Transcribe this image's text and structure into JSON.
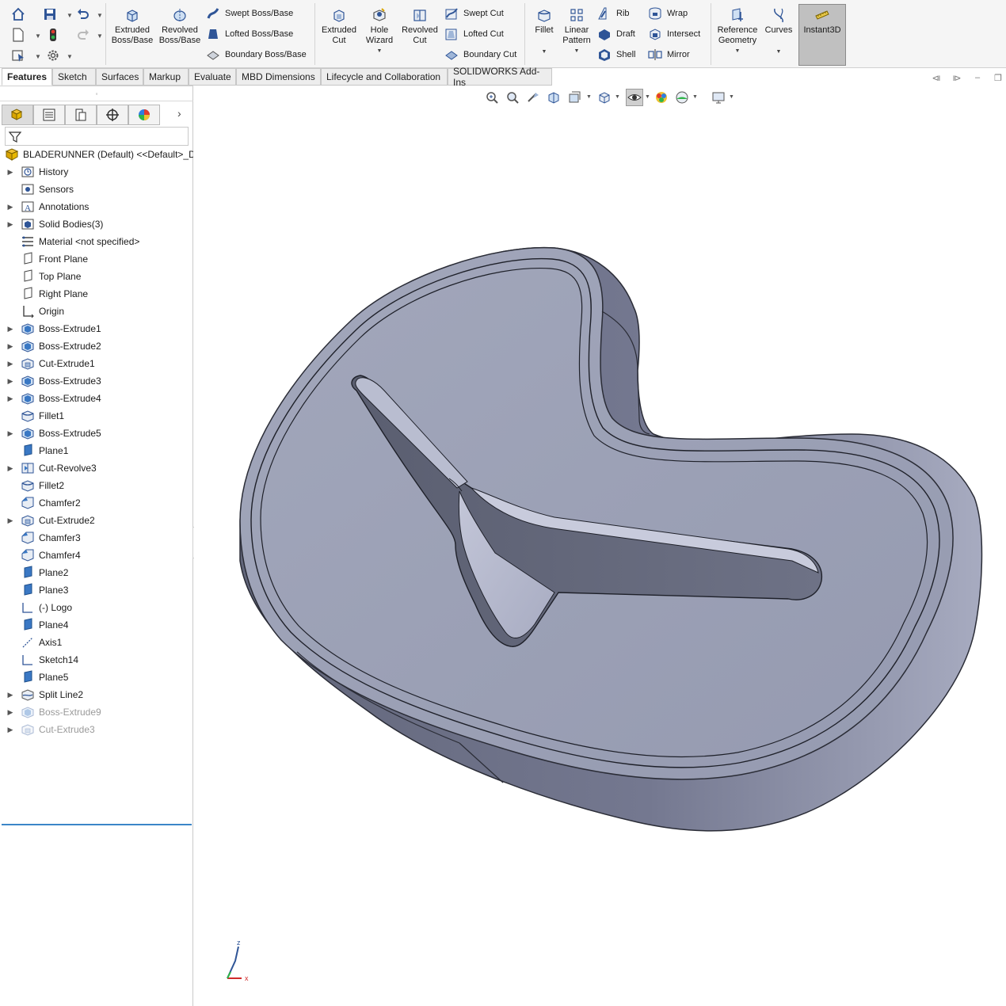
{
  "ribbon": {
    "features": {
      "extruded_boss": "Extruded\nBoss/Base",
      "revolved_boss": "Revolved\nBoss/Base",
      "swept_boss": "Swept Boss/Base",
      "lofted_boss": "Lofted Boss/Base",
      "boundary_boss": "Boundary Boss/Base",
      "extruded_cut": "Extruded\nCut",
      "hole_wizard": "Hole\nWizard",
      "revolved_cut": "Revolved\nCut",
      "swept_cut": "Swept Cut",
      "lofted_cut": "Lofted Cut",
      "boundary_cut": "Boundary Cut",
      "fillet": "Fillet",
      "linear_pattern": "Linear\nPattern",
      "rib": "Rib",
      "draft": "Draft",
      "shell": "Shell",
      "wrap": "Wrap",
      "intersect": "Intersect",
      "mirror": "Mirror",
      "reference_geometry": "Reference\nGeometry",
      "curves": "Curves",
      "instant3d": "Instant3D"
    }
  },
  "tabs": [
    "Features",
    "Sketch",
    "Surfaces",
    "Markup",
    "Evaluate",
    "MBD Dimensions",
    "Lifecycle and Collaboration",
    "SOLIDWORKS Add-Ins"
  ],
  "tree": {
    "root": "BLADERUNNER (Default) <<Default>_Di",
    "items": [
      {
        "label": "History",
        "icon": "history-icon",
        "expand": true
      },
      {
        "label": "Sensors",
        "icon": "sensors-icon",
        "expand": false
      },
      {
        "label": "Annotations",
        "icon": "annotations-icon",
        "expand": true
      },
      {
        "label": "Solid Bodies(3)",
        "icon": "solid-bodies-icon",
        "expand": true
      },
      {
        "label": "Material <not specified>",
        "icon": "material-icon",
        "expand": false
      },
      {
        "label": "Front Plane",
        "icon": "plane-outline-icon",
        "expand": false
      },
      {
        "label": "Top Plane",
        "icon": "plane-outline-icon",
        "expand": false
      },
      {
        "label": "Right Plane",
        "icon": "plane-outline-icon",
        "expand": false
      },
      {
        "label": "Origin",
        "icon": "origin-icon",
        "expand": false
      },
      {
        "label": "Boss-Extrude1",
        "icon": "boss-extrude-icon",
        "expand": true
      },
      {
        "label": "Boss-Extrude2",
        "icon": "boss-extrude-icon",
        "expand": true
      },
      {
        "label": "Cut-Extrude1",
        "icon": "cut-extrude-icon",
        "expand": true
      },
      {
        "label": "Boss-Extrude3",
        "icon": "boss-extrude-icon",
        "expand": true
      },
      {
        "label": "Boss-Extrude4",
        "icon": "boss-extrude-icon",
        "expand": true
      },
      {
        "label": "Fillet1",
        "icon": "fillet-icon",
        "expand": false
      },
      {
        "label": "Boss-Extrude5",
        "icon": "boss-extrude-icon",
        "expand": true
      },
      {
        "label": "Plane1",
        "icon": "plane-icon",
        "expand": false
      },
      {
        "label": "Cut-Revolve3",
        "icon": "cut-revolve-icon",
        "expand": true
      },
      {
        "label": "Fillet2",
        "icon": "fillet-icon",
        "expand": false
      },
      {
        "label": "Chamfer2",
        "icon": "chamfer-icon",
        "expand": false
      },
      {
        "label": "Cut-Extrude2",
        "icon": "cut-extrude-icon",
        "expand": true
      },
      {
        "label": "Chamfer3",
        "icon": "chamfer-icon",
        "expand": false
      },
      {
        "label": "Chamfer4",
        "icon": "chamfer-icon",
        "expand": false
      },
      {
        "label": "Plane2",
        "icon": "plane-icon",
        "expand": false
      },
      {
        "label": "Plane3",
        "icon": "plane-icon",
        "expand": false
      },
      {
        "label": "(-) Logo",
        "icon": "sketch-icon",
        "expand": false
      },
      {
        "label": "Plane4",
        "icon": "plane-icon",
        "expand": false
      },
      {
        "label": "Axis1",
        "icon": "axis-icon",
        "expand": false
      },
      {
        "label": "Sketch14",
        "icon": "sketch-icon",
        "expand": false
      },
      {
        "label": "Plane5",
        "icon": "plane-icon",
        "expand": false
      },
      {
        "label": "Split Line2",
        "icon": "split-line-icon",
        "expand": true
      },
      {
        "label": "Boss-Extrude9",
        "icon": "boss-extrude-icon",
        "expand": true,
        "suppressed": true
      },
      {
        "label": "Cut-Extrude3",
        "icon": "cut-extrude-icon",
        "expand": true,
        "suppressed": true
      }
    ]
  },
  "triad": {
    "z": "z",
    "x": "x"
  },
  "colors": {
    "ribbon_bg": "#f5f5f5",
    "model_top": "#9a9fb4",
    "model_side": "#6f7386",
    "selection_blue": "#3c86c8"
  }
}
